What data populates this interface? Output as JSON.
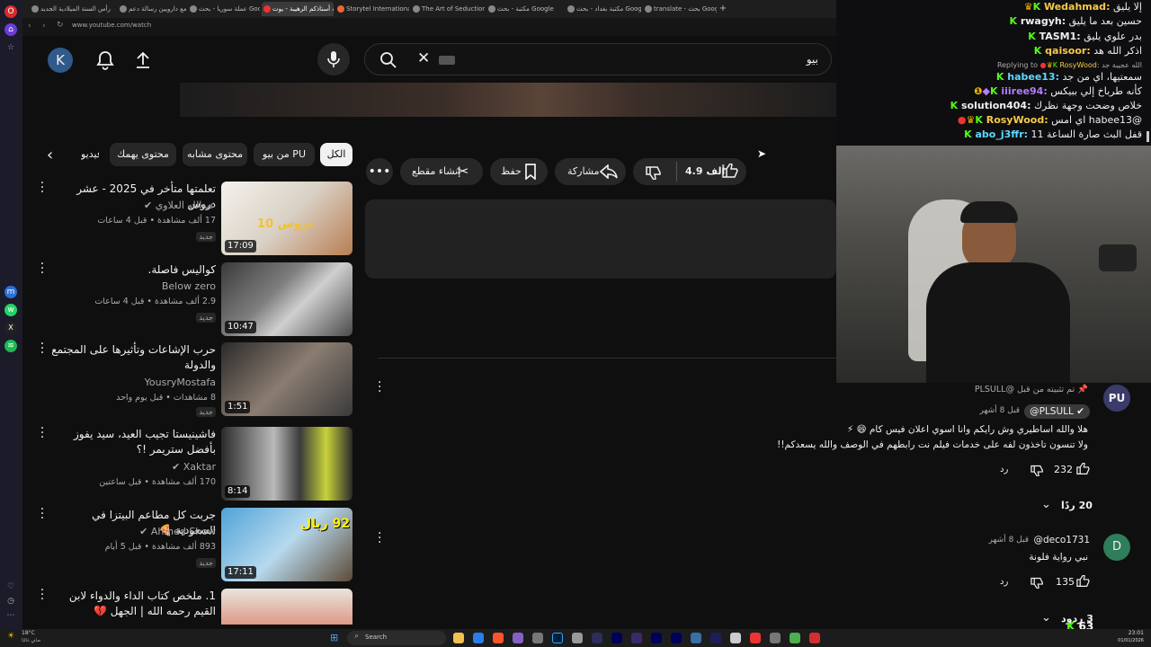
{
  "browser": {
    "tabs": [
      {
        "label": "رأس السنة الميلادية الجديد"
      },
      {
        "label": "كلنا مع دارويين رسالة دعم"
      },
      {
        "label": "عملة سوريا - بحث Google"
      },
      {
        "label": "جاويت أستاذكم الرهيبة - يوت"
      },
      {
        "label": "Storytel International - A"
      },
      {
        "label": "The Art of Seduction by R"
      },
      {
        "label": "مكتبة - بحث Google"
      },
      {
        "label": "مكتبة بغداد - بحث Google"
      },
      {
        "label": "translate - بحث Google"
      }
    ],
    "new_tab": "+",
    "url": "www.youtube.com/watch"
  },
  "yt_header": {
    "avatar_letter": "K",
    "search_value": "بيو",
    "keyboard_icon": "keyboard-icon"
  },
  "chips": [
    "الكل",
    "من بيو PU",
    "محتوى مشابه",
    "محتوى يهمك",
    "فيديو"
  ],
  "actions": {
    "like_count": "4.9 ألف",
    "share": "مشاركة",
    "save": "حفظ",
    "clip": "إنشاء مقطع"
  },
  "videos": [
    {
      "title": "تعلمتها متأخر في 2025 - عشر دروس",
      "channel": "عبدالله العلاوي",
      "meta": "17 ألف مشاهدة • قبل 4 ساعات",
      "badge": "جديد",
      "duration": "17:09",
      "thumb_text": "10 دروس",
      "verified": true
    },
    {
      "title": "كواليس فاصلة.",
      "channel": "Below zero",
      "meta": "2.9 ألف مشاهدة • قبل 4 ساعات",
      "badge": "جديد",
      "duration": "10:47",
      "verified": false
    },
    {
      "title": "حرب الإشاعات وتأثيرها على المجتمع والدولة",
      "channel": "YousryMostafa",
      "meta": "8 مشاهدات • قبل يوم واحد",
      "badge": "جديد",
      "duration": "1:51",
      "verified": false
    },
    {
      "title": "فاشينيستا تجيب العيد، سيد يفوز بأفضل ستريمر !؟",
      "channel": "Xaktar",
      "meta": "170 ألف مشاهدة • قبل ساعتين",
      "badge": "",
      "duration": "8:14",
      "verified": true
    },
    {
      "title": "جربت كل مطاعم البيتزا في السعودية 🍕",
      "channel": "Ahmed Show",
      "meta": "893 ألف مشاهدة • قبل 5 أيام",
      "badge": "جديد",
      "duration": "17:11",
      "thumb_text": "92 ريال",
      "verified": true
    },
    {
      "title": "1. ملخص كتاب الداء والدواء لابن القيم رحمه الله | الجهل 💔",
      "channel": "",
      "meta": "",
      "badge": "",
      "duration": "",
      "verified": false
    }
  ],
  "chat": [
    {
      "user": "Wedahmad",
      "msg": "إلا يليق",
      "color": "#f7c948"
    },
    {
      "user": "rwagyh",
      "msg": "حسين بعد ما يليق",
      "color": "#efeff1"
    },
    {
      "user": "TASM1",
      "msg": "بدر علوي يليق",
      "color": "#efeff1"
    },
    {
      "user": "qaisoor",
      "msg": "اذكر الله هد",
      "color": "#f7c948"
    },
    {
      "reply_prefix": "Replying to",
      "user": "RosyWood",
      "msg": "الله عجيبة جد",
      "color": "#f7c948",
      "is_reply_header": true
    },
    {
      "user": "habee13",
      "msg": "سمعتيها، اي من جد",
      "color": "#5fd7ff"
    },
    {
      "user": "iiiree94",
      "msg": "كأنه طرباخ إلي ببيكس",
      "color": "#b57cff"
    },
    {
      "user": "solution404",
      "msg": "خلاص وضحت وجهة نظرك",
      "color": "#efeff1"
    },
    {
      "user": "RosyWood",
      "msg": "@habee13 اي امس",
      "color": "#f7c948"
    },
    {
      "user": "abo_j3ffr",
      "msg": "قفل البث صارة الساعة 11",
      "color": "#5fd7ff"
    }
  ],
  "comments": [
    {
      "pinned": "تم تثبيته من قبل @PLSULL",
      "author": "@PLSULL",
      "time": "قبل 8 أشهر",
      "avatar": "PU",
      "avatar_color": "#3b3b6a",
      "line1": "هلا والله اساطيري وش رايكم وانا اسوي اعلان فيس كام 😄 ⚡",
      "line2": "ولا تنسون تاخذون لفه على خدمات فيلم نت رابطهم في الوصف والله يسعدكم!!",
      "likes": "232",
      "reply": "رد",
      "replies": "20 ردًا"
    },
    {
      "author": "@deco1731",
      "time": "قبل 8 أشهر",
      "avatar": "D",
      "avatar_color": "#2e7d5b",
      "line1": "نبي رواية فلونة",
      "likes": "135",
      "reply": "رد",
      "replies": "3 ردود"
    }
  ],
  "stream_overlay": {
    "viewer_count": "63"
  },
  "taskbar": {
    "weather": "18°C",
    "weather_sub": "صافٍ غالبًا",
    "search": "Search",
    "time": "23:01",
    "date": "01/01/2026"
  }
}
